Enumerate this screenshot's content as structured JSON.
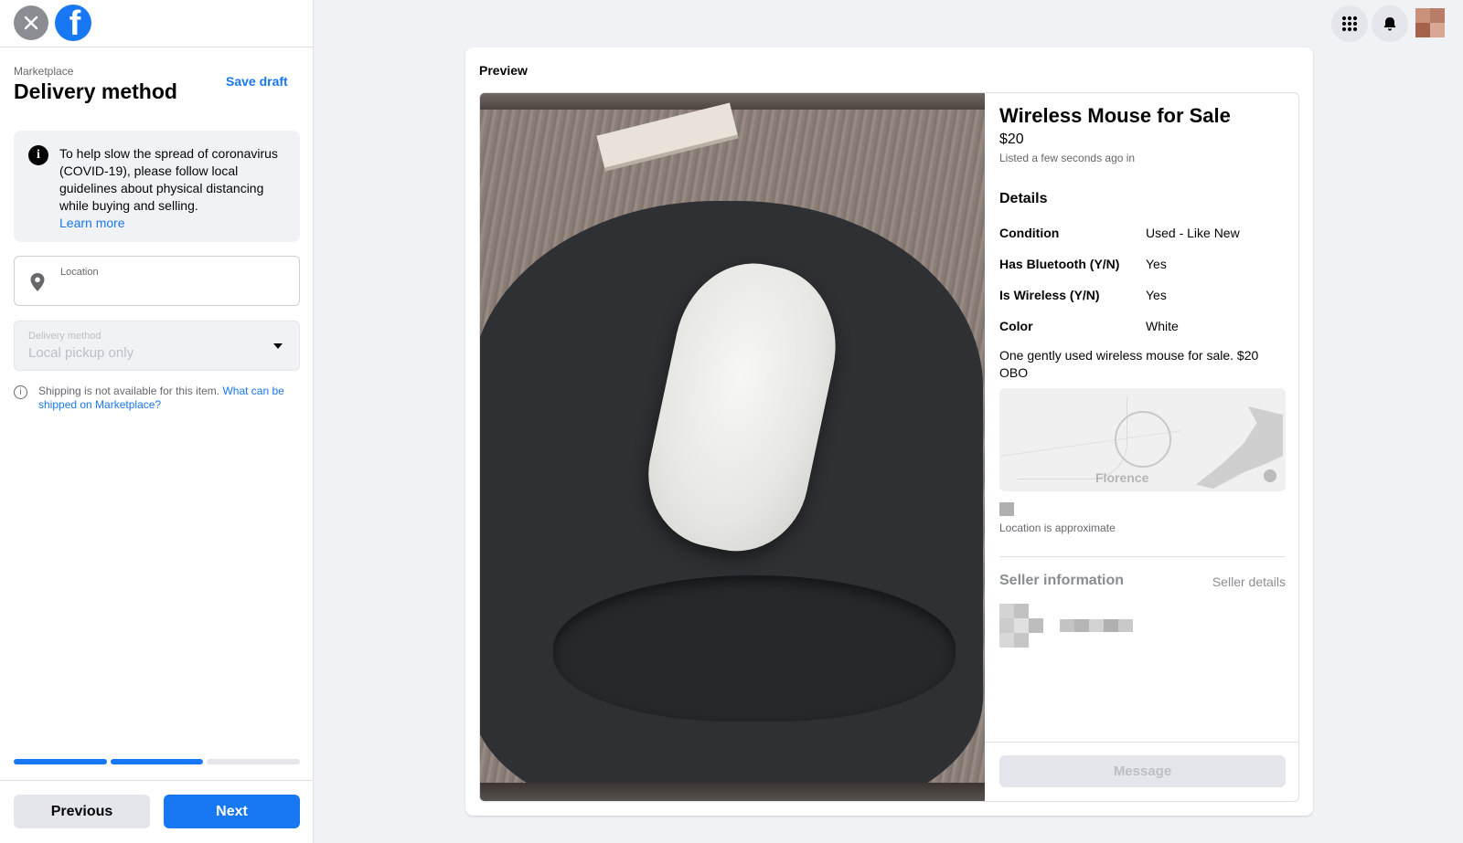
{
  "sidebar": {
    "breadcrumb": "Marketplace",
    "title": "Delivery method",
    "save_draft": "Save draft",
    "notice": {
      "text": "To help slow the spread of coronavirus (COVID-19), please follow local guidelines about physical distancing while buying and selling.",
      "link": "Learn more"
    },
    "location": {
      "label": "Location",
      "value": ""
    },
    "delivery": {
      "label": "Delivery method",
      "value": "Local pickup only"
    },
    "shipping_info": {
      "text": "Shipping is not available for this item.",
      "link": "What can be shipped on Marketplace?"
    },
    "progress": {
      "steps_total": 3,
      "steps_complete": 2
    },
    "buttons": {
      "previous": "Previous",
      "next": "Next"
    }
  },
  "header_icons": [
    "apps-grid-icon",
    "notifications-bell-icon",
    "profile-avatar"
  ],
  "preview": {
    "heading": "Preview",
    "listing": {
      "title": "Wireless Mouse for Sale",
      "price": "$20",
      "listed": "Listed a few seconds ago in",
      "details_heading": "Details",
      "details": [
        {
          "key": "Condition",
          "value": "Used - Like New"
        },
        {
          "key": "Has Bluetooth (Y/N)",
          "value": "Yes"
        },
        {
          "key": "Is Wireless (Y/N)",
          "value": "Yes"
        },
        {
          "key": "Color",
          "value": "White"
        }
      ],
      "description": "One gently used wireless mouse for sale. $20 OBO",
      "map_label": "Florence",
      "location_note": "Location is approximate",
      "seller_heading": "Seller information",
      "seller_details_link": "Seller details",
      "message_button": "Message"
    }
  },
  "colors": {
    "accent": "#1877f2",
    "background": "#f0f2f5",
    "text_primary": "#050505",
    "text_secondary": "#65676b"
  }
}
